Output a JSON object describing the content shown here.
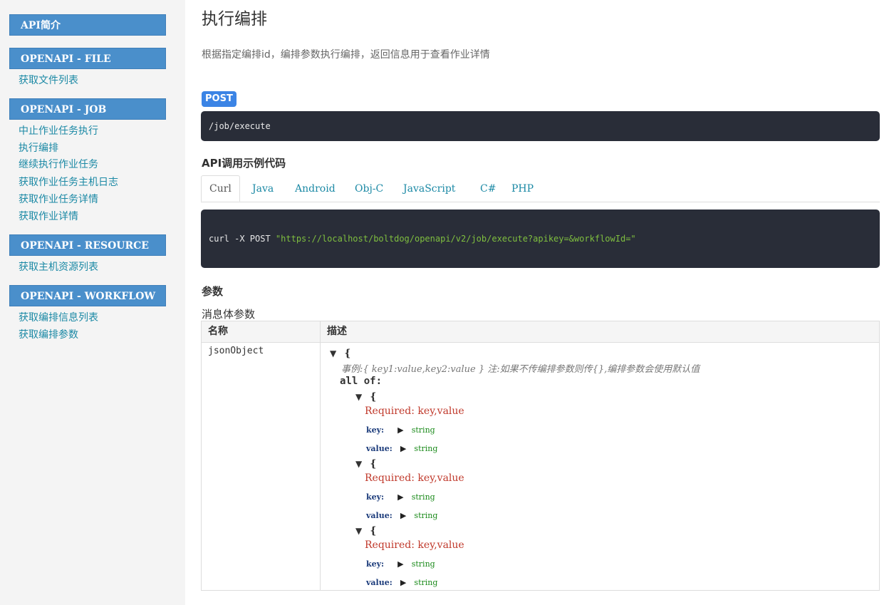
{
  "sidebar": {
    "sections": [
      {
        "title": "API简介",
        "items": []
      },
      {
        "title": "OPENAPI - FILE",
        "items": [
          "获取文件列表"
        ]
      },
      {
        "title": "OPENAPI - JOB",
        "items": [
          "中止作业任务执行",
          "执行编排",
          "继续执行作业任务",
          "获取作业任务主机日志",
          "获取作业任务详情",
          "获取作业详情"
        ]
      },
      {
        "title": "OPENAPI - RESOURCE",
        "items": [
          "获取主机资源列表"
        ]
      },
      {
        "title": "OPENAPI - WORKFLOW",
        "items": [
          "获取编排信息列表",
          "获取编排参数"
        ]
      }
    ]
  },
  "main": {
    "title": "执行编排",
    "description": "根据指定编排id，编排参数执行编排，返回信息用于查看作业详情",
    "method": "POST",
    "endpoint": "/job/execute",
    "example_heading": "API调用示例代码",
    "tabs": [
      "Curl",
      "Java",
      "Android",
      "Obj-C",
      "JavaScript",
      "C#",
      "PHP"
    ],
    "active_tab": "Curl",
    "code": {
      "command": "curl -X POST ",
      "url": "\"https://localhost/boltdog/openapi/v2/job/execute?apikey=&workflowId=\""
    },
    "params_heading": "参数",
    "body_params_label": "消息体参数",
    "table": {
      "col_name": "名称",
      "col_desc": "描述",
      "param_name": "jsonObject",
      "open_brace": "{",
      "example": "事例:{ key1:value,key2:value } 注:如果不传编排参数则传{},编排参数会使用默认值",
      "all_of": "all of:",
      "groups": [
        {
          "required": "Required: key,value",
          "key_label": "key:",
          "key_type": "string",
          "value_label": "value:",
          "value_type": "string"
        },
        {
          "required": "Required: key,value",
          "key_label": "key:",
          "key_type": "string",
          "value_label": "value:",
          "value_type": "string"
        },
        {
          "required": "Required: key,value",
          "key_label": "key:",
          "key_type": "string",
          "value_label": "value:",
          "value_type": "string"
        }
      ]
    }
  },
  "colors": {
    "sidebar_header": "#4a8fcb",
    "link": "#1b89a5",
    "method_badge": "#3b84e5",
    "code_bg": "#292d38",
    "code_string": "#7fbf3f",
    "required": "#c0392b",
    "type": "#1a8a1a"
  }
}
